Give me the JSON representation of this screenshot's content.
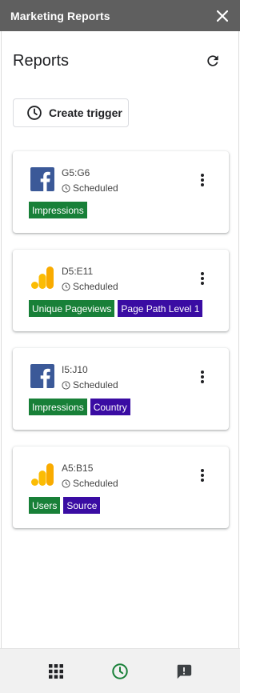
{
  "window": {
    "title": "Marketing Reports"
  },
  "header": {
    "title": "Reports"
  },
  "create_trigger": {
    "label": "Create trigger"
  },
  "reports": [
    {
      "source": "facebook",
      "range": "G5:G6",
      "status": "Scheduled",
      "chips": [
        {
          "label": "Impressions",
          "kind": "metric"
        }
      ]
    },
    {
      "source": "google-analytics",
      "range": "D5:E11",
      "status": "Scheduled",
      "chips": [
        {
          "label": "Unique Pageviews",
          "kind": "metric"
        },
        {
          "label": "Page Path Level 1",
          "kind": "dimension"
        }
      ]
    },
    {
      "source": "facebook",
      "range": "I5:J10",
      "status": "Scheduled",
      "chips": [
        {
          "label": "Impressions",
          "kind": "metric"
        },
        {
          "label": "Country",
          "kind": "dimension"
        }
      ]
    },
    {
      "source": "google-analytics",
      "range": "A5:B15",
      "status": "Scheduled",
      "chips": [
        {
          "label": "Users",
          "kind": "metric"
        },
        {
          "label": "Source",
          "kind": "dimension"
        }
      ]
    }
  ],
  "bottom_nav": [
    {
      "icon": "apps-grid-icon"
    },
    {
      "icon": "schedule-clock-icon",
      "active": true
    },
    {
      "icon": "feedback-icon"
    }
  ],
  "colors": {
    "titlebar": "#5f5f5f",
    "metric_chip": "#188038",
    "dimension_chip": "#3a0ca3",
    "facebook_blue": "#3b5998",
    "ga_orange": "#f9ab00",
    "ga_yellow": "#fbbc04",
    "active_nav": "#188038"
  }
}
